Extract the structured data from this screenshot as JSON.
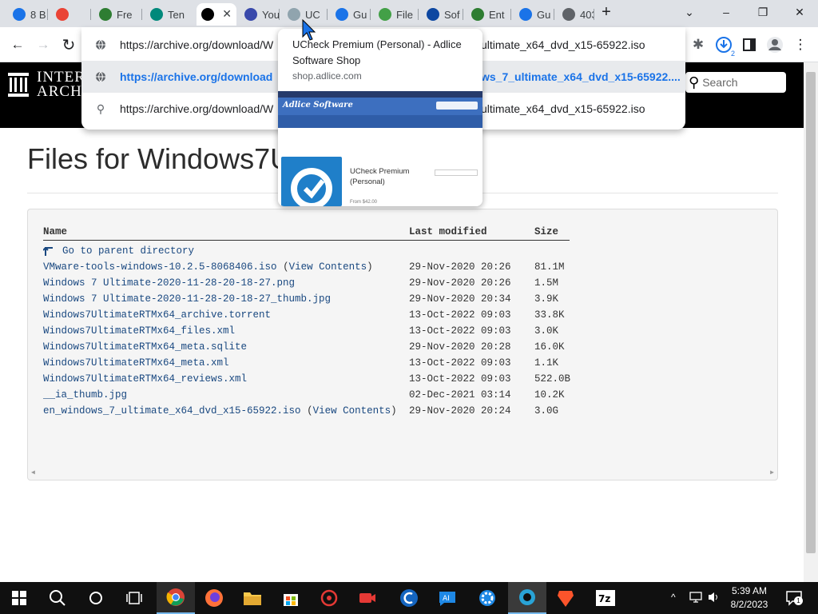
{
  "tabs": [
    {
      "label": "8 B",
      "color": "#1a73e8"
    },
    {
      "label": "",
      "color": "#ea4335"
    },
    {
      "label": "Fre",
      "color": "#2e7d32"
    },
    {
      "label": "Ten",
      "color": "#00897b"
    },
    {
      "label": "",
      "color": "#000000",
      "close": "✕"
    },
    {
      "label": "You",
      "color": "#3949ab"
    },
    {
      "label": "UC",
      "color": "#90a4ae"
    },
    {
      "label": "Gu",
      "color": "#1a73e8"
    },
    {
      "label": "File",
      "color": "#43a047"
    },
    {
      "label": "Sof",
      "color": "#0d47a1"
    },
    {
      "label": "Ent",
      "color": "#2e7d32"
    },
    {
      "label": "Gu",
      "color": "#1a73e8"
    },
    {
      "label": "403",
      "color": "#5f6368"
    }
  ],
  "new_tab": "+",
  "window": {
    "tab_search": "⌄",
    "minimize": "–",
    "maximize": "❐",
    "close": "✕"
  },
  "toolbar": {
    "back": "←",
    "forward": "→",
    "reload": "↻",
    "extensions": "✱",
    "download_badge": "2",
    "menu": "⋮"
  },
  "omnibox": {
    "rows": [
      {
        "text": "https://archive.org/download/W",
        "tail": "ultimate_x64_dvd_x15-65922.iso",
        "icon": "globe"
      },
      {
        "text": "https://archive.org/download",
        "tail": "ws_7_ultimate_x64_dvd_x15-65922....",
        "icon": "globe"
      },
      {
        "text": "https://archive.org/download/W",
        "tail": "ultimate_x64_dvd_x15-65922.iso",
        "icon": "search"
      }
    ]
  },
  "hovercard": {
    "title": "UCheck Premium (Personal) - Adlice Software Shop",
    "domain": "shop.adlice.com",
    "thumb_brand": "Adlice Software",
    "thumb_product": "UCheck Premium (Personal)",
    "thumb_price": "From $42.00"
  },
  "site": {
    "logo_line1": "INTER",
    "logo_line2": "ARCHI",
    "search_placeholder": "Search"
  },
  "page": {
    "title": "Files for Windows7U",
    "headers": {
      "name": "Name",
      "modified": "Last modified",
      "size": "Size"
    },
    "parent_link": "Go to parent directory",
    "files": [
      {
        "name": "VMware-tools-windows-10.2.5-8068406.iso",
        "extra": "(View Contents)",
        "date": "29-Nov-2020 20:26",
        "size": "81.1M"
      },
      {
        "name": "Windows 7 Ultimate-2020-11-28-20-18-27.png",
        "extra": "",
        "date": "29-Nov-2020 20:26",
        "size": "1.5M"
      },
      {
        "name": "Windows 7 Ultimate-2020-11-28-20-18-27_thumb.jpg",
        "extra": "",
        "date": "29-Nov-2020 20:34",
        "size": "3.9K"
      },
      {
        "name": "Windows7UltimateRTMx64_archive.torrent",
        "extra": "",
        "date": "13-Oct-2022 09:03",
        "size": "33.8K"
      },
      {
        "name": "Windows7UltimateRTMx64_files.xml",
        "extra": "",
        "date": "13-Oct-2022 09:03",
        "size": "3.0K"
      },
      {
        "name": "Windows7UltimateRTMx64_meta.sqlite",
        "extra": "",
        "date": "29-Nov-2020 20:28",
        "size": "16.0K"
      },
      {
        "name": "Windows7UltimateRTMx64_meta.xml",
        "extra": "",
        "date": "13-Oct-2022 09:03",
        "size": "1.1K"
      },
      {
        "name": "Windows7UltimateRTMx64_reviews.xml",
        "extra": "",
        "date": "13-Oct-2022 09:03",
        "size": "522.0B"
      },
      {
        "name": "__ia_thumb.jpg",
        "extra": "",
        "date": "02-Dec-2021 03:14",
        "size": "10.2K"
      },
      {
        "name": "en_windows_7_ultimate_x64_dvd_x15-65922.iso",
        "extra": "(View Contents)",
        "date": "29-Nov-2020 20:24",
        "size": "3.0G"
      }
    ]
  },
  "taskbar": {
    "time": "5:39 AM",
    "date": "8/2/2023",
    "notification_count": "1"
  },
  "colors": {
    "link": "#194880",
    "accent": "#1a73e8",
    "header_bg": "#000000",
    "taskbar_bg": "#101010"
  }
}
